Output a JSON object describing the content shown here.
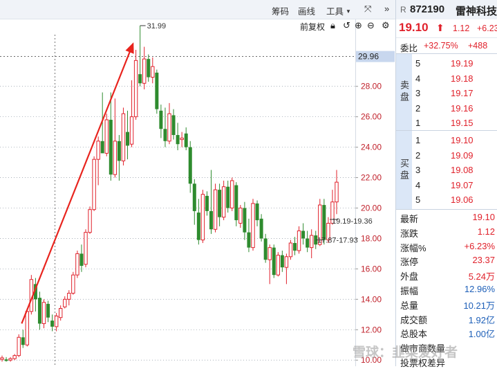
{
  "toolbar": {
    "chips_label": "筹码",
    "draw_label": "画线",
    "tools_label": "工具",
    "expand_icon": "expand-arrows-icon",
    "collapse_icon": "double-chevron-right-icon"
  },
  "subbar": {
    "adjust_label": "前复权",
    "icons": [
      "lock-icon",
      "undo-icon",
      "zoom-in-icon",
      "zoom-out-icon",
      "gear-icon"
    ]
  },
  "stock": {
    "market_tag": "R",
    "code": "872190",
    "name": "雷神科技",
    "last_price": "19.10",
    "up_arrow": "⬆",
    "change": "1.12",
    "change_pct": "+6.23%"
  },
  "ratio": {
    "label": "委比",
    "pct": "+32.75%",
    "diff": "+488"
  },
  "sell_book": {
    "label": "卖盘",
    "rows": [
      {
        "level": "5",
        "price": "19.19"
      },
      {
        "level": "4",
        "price": "19.18"
      },
      {
        "level": "3",
        "price": "19.17"
      },
      {
        "level": "2",
        "price": "19.16"
      },
      {
        "level": "1",
        "price": "19.15"
      }
    ]
  },
  "buy_book": {
    "label": "买盘",
    "rows": [
      {
        "level": "1",
        "price": "19.10"
      },
      {
        "level": "2",
        "price": "19.09"
      },
      {
        "level": "3",
        "price": "19.08"
      },
      {
        "level": "4",
        "price": "19.07"
      },
      {
        "level": "5",
        "price": "19.06"
      }
    ]
  },
  "stats": [
    {
      "key": "最新",
      "value": "19.10",
      "color": "red"
    },
    {
      "key": "涨跌",
      "value": "1.12",
      "color": "red"
    },
    {
      "key": "涨幅%",
      "value": "+6.23%",
      "color": "red"
    },
    {
      "key": "涨停",
      "value": "23.37",
      "color": "red"
    },
    {
      "key": "外盘",
      "value": "5.24万",
      "color": "red"
    },
    {
      "key": "振幅",
      "value": "12.96%",
      "color": "blue"
    },
    {
      "key": "总量",
      "value": "10.21万",
      "color": "blue"
    },
    {
      "key": "成交额",
      "value": "1.92亿",
      "color": "blue"
    },
    {
      "key": "总股本",
      "value": "1.00亿",
      "color": "blue"
    },
    {
      "key": "做市商数量",
      "value": "",
      "color": "dark"
    },
    {
      "key": "投票权差异",
      "value": "",
      "color": "dark"
    }
  ],
  "watermark": "雪球：韭菜爱好者",
  "colors": {
    "up": "#e0202a",
    "down": "#2e8b2e",
    "axis_text": "#c0202a",
    "accent_blue": "#1d5fb8"
  },
  "chart_data": {
    "type": "candlestick",
    "y_ticks": [
      "10.00",
      "12.00",
      "14.00",
      "16.00",
      "18.00",
      "20.00",
      "22.00",
      "24.00",
      "26.00",
      "28.00"
    ],
    "ylim": [
      9.6,
      31.4
    ],
    "price_line": {
      "value": 29.96,
      "label": "29.96"
    },
    "annotations": [
      {
        "text": "31.99",
        "kind": "high"
      },
      {
        "text": "19.19-19.36",
        "kind": "range"
      },
      {
        "text": "17.87-17.93",
        "kind": "range"
      }
    ],
    "trend_arrow": {
      "from_index": 7,
      "from_price": 13.5,
      "to_index": 28,
      "to_price": 30.8
    },
    "candles": [
      {
        "o": 10.05,
        "h": 10.3,
        "l": 9.9,
        "c": 10.15
      },
      {
        "o": 10.05,
        "h": 10.2,
        "l": 9.9,
        "c": 9.95
      },
      {
        "o": 10.0,
        "h": 10.2,
        "l": 9.9,
        "c": 10.1
      },
      {
        "o": 10.1,
        "h": 10.4,
        "l": 10.0,
        "c": 10.3
      },
      {
        "o": 10.3,
        "h": 11.7,
        "l": 10.2,
        "c": 11.5
      },
      {
        "o": 11.5,
        "h": 12.0,
        "l": 10.8,
        "c": 11.0
      },
      {
        "o": 11.0,
        "h": 13.4,
        "l": 10.9,
        "c": 13.2
      },
      {
        "o": 13.2,
        "h": 15.6,
        "l": 13.0,
        "c": 15.3
      },
      {
        "o": 15.0,
        "h": 15.4,
        "l": 13.2,
        "c": 14.0
      },
      {
        "o": 14.1,
        "h": 14.5,
        "l": 12.0,
        "c": 12.4
      },
      {
        "o": 12.4,
        "h": 14.0,
        "l": 12.1,
        "c": 13.8
      },
      {
        "o": 13.7,
        "h": 13.9,
        "l": 12.5,
        "c": 12.8
      },
      {
        "o": 12.6,
        "h": 13.0,
        "l": 11.9,
        "c": 12.2
      },
      {
        "o": 12.2,
        "h": 13.1,
        "l": 11.9,
        "c": 12.9
      },
      {
        "o": 12.8,
        "h": 13.6,
        "l": 12.6,
        "c": 13.4
      },
      {
        "o": 13.5,
        "h": 14.2,
        "l": 13.4,
        "c": 14.0
      },
      {
        "o": 14.0,
        "h": 14.6,
        "l": 13.6,
        "c": 14.4
      },
      {
        "o": 14.4,
        "h": 15.8,
        "l": 14.3,
        "c": 15.6
      },
      {
        "o": 15.6,
        "h": 17.2,
        "l": 15.4,
        "c": 17.0
      },
      {
        "o": 17.0,
        "h": 17.6,
        "l": 15.8,
        "c": 16.2
      },
      {
        "o": 16.3,
        "h": 18.6,
        "l": 16.1,
        "c": 18.4
      },
      {
        "o": 18.4,
        "h": 20.1,
        "l": 18.3,
        "c": 19.9
      },
      {
        "o": 19.9,
        "h": 23.4,
        "l": 19.8,
        "c": 23.2
      },
      {
        "o": 23.2,
        "h": 24.7,
        "l": 21.5,
        "c": 24.4
      },
      {
        "o": 24.4,
        "h": 27.6,
        "l": 24.2,
        "c": 23.6
      },
      {
        "o": 23.6,
        "h": 26.2,
        "l": 23.4,
        "c": 25.8
      },
      {
        "o": 25.8,
        "h": 27.6,
        "l": 21.8,
        "c": 22.2
      },
      {
        "o": 22.2,
        "h": 27.2,
        "l": 22.0,
        "c": 24.4
      },
      {
        "o": 24.4,
        "h": 24.8,
        "l": 21.8,
        "c": 23.1
      },
      {
        "o": 23.1,
        "h": 26.6,
        "l": 22.8,
        "c": 26.2
      },
      {
        "o": 25.0,
        "h": 26.4,
        "l": 23.2,
        "c": 24.1
      },
      {
        "o": 24.2,
        "h": 28.4,
        "l": 24.0,
        "c": 26.0
      },
      {
        "o": 26.0,
        "h": 30.4,
        "l": 25.8,
        "c": 29.7
      },
      {
        "o": 28.8,
        "h": 31.99,
        "l": 28.0,
        "c": 28.2
      },
      {
        "o": 28.2,
        "h": 30.6,
        "l": 27.8,
        "c": 29.8
      },
      {
        "o": 29.8,
        "h": 30.1,
        "l": 28.3,
        "c": 28.6
      },
      {
        "o": 28.6,
        "h": 29.9,
        "l": 28.2,
        "c": 29.3
      },
      {
        "o": 28.9,
        "h": 29.1,
        "l": 26.2,
        "c": 26.5
      },
      {
        "o": 26.4,
        "h": 26.8,
        "l": 24.6,
        "c": 25.2
      },
      {
        "o": 25.2,
        "h": 26.6,
        "l": 24.0,
        "c": 24.4
      },
      {
        "o": 24.4,
        "h": 26.9,
        "l": 24.2,
        "c": 26.2
      },
      {
        "o": 26.1,
        "h": 26.5,
        "l": 24.5,
        "c": 24.8
      },
      {
        "o": 24.8,
        "h": 25.6,
        "l": 23.8,
        "c": 24.2
      },
      {
        "o": 24.5,
        "h": 25.0,
        "l": 24.0,
        "c": 24.6
      },
      {
        "o": 24.9,
        "h": 25.3,
        "l": 23.8,
        "c": 24.0
      },
      {
        "o": 24.0,
        "h": 24.4,
        "l": 21.0,
        "c": 21.6
      },
      {
        "o": 21.6,
        "h": 21.9,
        "l": 18.9,
        "c": 19.8
      },
      {
        "o": 19.7,
        "h": 20.6,
        "l": 17.6,
        "c": 17.9
      },
      {
        "o": 17.9,
        "h": 21.2,
        "l": 17.7,
        "c": 20.9
      },
      {
        "o": 20.8,
        "h": 21.1,
        "l": 19.5,
        "c": 19.8
      },
      {
        "o": 19.8,
        "h": 22.5,
        "l": 18.3,
        "c": 18.6
      },
      {
        "o": 18.6,
        "h": 21.6,
        "l": 18.4,
        "c": 21.2
      },
      {
        "o": 21.2,
        "h": 21.6,
        "l": 18.8,
        "c": 19.4
      },
      {
        "o": 19.4,
        "h": 21.8,
        "l": 19.2,
        "c": 21.4
      },
      {
        "o": 21.4,
        "h": 21.8,
        "l": 19.7,
        "c": 20.0
      },
      {
        "o": 20.0,
        "h": 22.0,
        "l": 19.8,
        "c": 21.8
      },
      {
        "o": 21.5,
        "h": 21.7,
        "l": 18.8,
        "c": 19.2
      },
      {
        "o": 19.0,
        "h": 20.2,
        "l": 18.7,
        "c": 20.0
      },
      {
        "o": 20.0,
        "h": 20.4,
        "l": 17.9,
        "c": 18.4
      },
      {
        "o": 18.4,
        "h": 19.3,
        "l": 17.1,
        "c": 17.4
      },
      {
        "o": 17.4,
        "h": 20.6,
        "l": 17.2,
        "c": 20.3
      },
      {
        "o": 20.3,
        "h": 20.5,
        "l": 18.8,
        "c": 19.2
      },
      {
        "o": 19.3,
        "h": 19.6,
        "l": 17.8,
        "c": 18.0
      },
      {
        "o": 18.0,
        "h": 18.3,
        "l": 16.4,
        "c": 16.6
      },
      {
        "o": 16.6,
        "h": 17.6,
        "l": 15.0,
        "c": 17.4
      },
      {
        "o": 17.4,
        "h": 17.6,
        "l": 15.4,
        "c": 15.6
      },
      {
        "o": 15.6,
        "h": 17.1,
        "l": 15.5,
        "c": 16.9
      },
      {
        "o": 16.9,
        "h": 17.2,
        "l": 15.8,
        "c": 16.1
      },
      {
        "o": 16.1,
        "h": 17.0,
        "l": 15.0,
        "c": 16.8
      },
      {
        "o": 16.8,
        "h": 17.9,
        "l": 16.6,
        "c": 17.7
      },
      {
        "o": 17.7,
        "h": 18.1,
        "l": 16.9,
        "c": 17.2
      },
      {
        "o": 17.2,
        "h": 18.8,
        "l": 17.0,
        "c": 18.5
      },
      {
        "o": 18.5,
        "h": 19.0,
        "l": 17.6,
        "c": 18.0
      },
      {
        "o": 18.0,
        "h": 18.5,
        "l": 17.1,
        "c": 17.4
      },
      {
        "o": 17.4,
        "h": 18.6,
        "l": 16.7,
        "c": 18.2
      },
      {
        "o": 18.2,
        "h": 18.5,
        "l": 17.3,
        "c": 17.6
      },
      {
        "o": 17.6,
        "h": 20.6,
        "l": 17.5,
        "c": 20.2
      },
      {
        "o": 20.2,
        "h": 20.6,
        "l": 17.6,
        "c": 17.9
      },
      {
        "o": 17.9,
        "h": 19.4,
        "l": 17.7,
        "c": 19.0
      },
      {
        "o": 19.0,
        "h": 21.2,
        "l": 18.9,
        "c": 20.4
      },
      {
        "o": 20.4,
        "h": 22.5,
        "l": 19.6,
        "c": 21.7
      }
    ]
  }
}
